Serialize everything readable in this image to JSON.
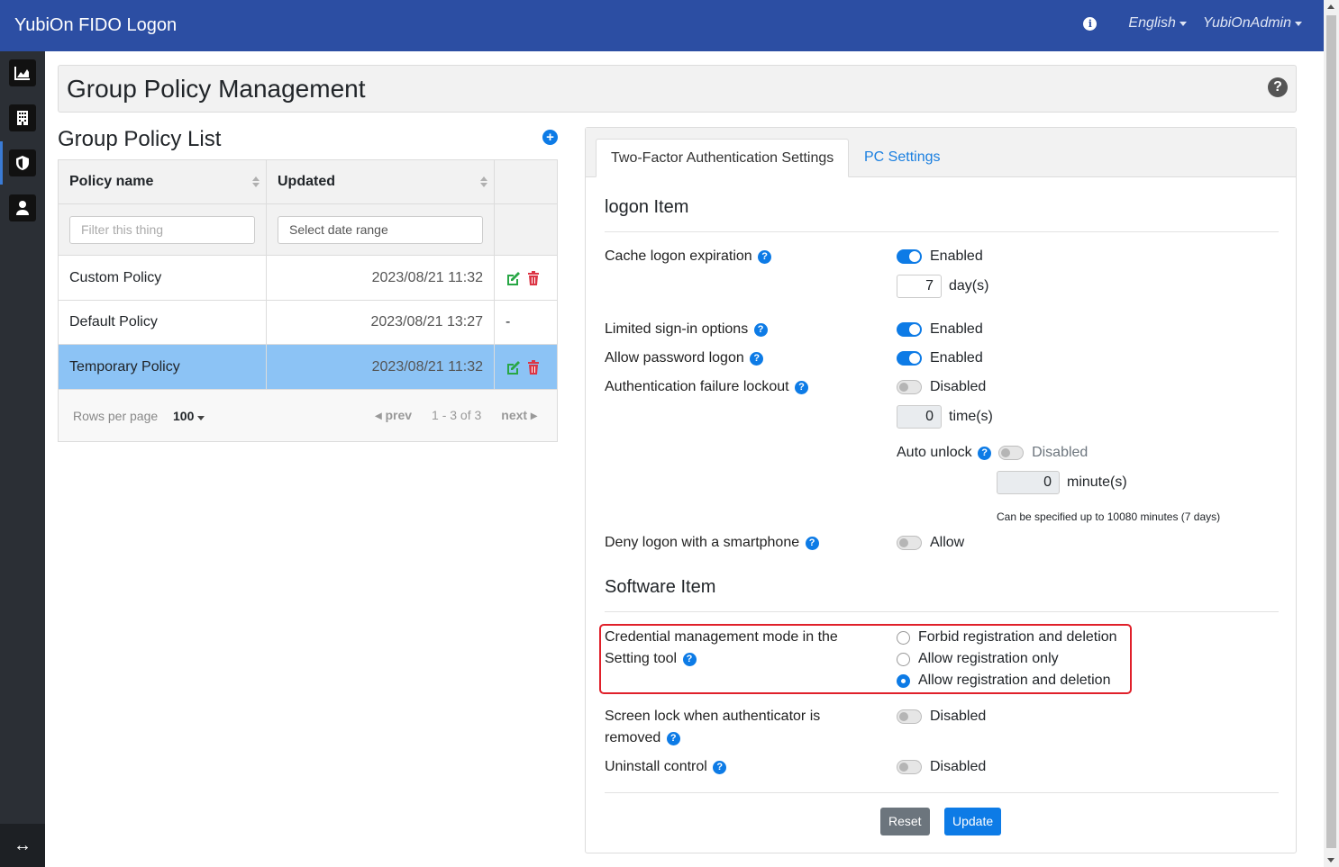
{
  "app": {
    "title": "YubiOn FIDO Logon",
    "language": "English",
    "user": "YubiOnAdmin"
  },
  "sidebar": {
    "items": [
      {
        "icon": "chart-area-icon"
      },
      {
        "icon": "building-icon"
      },
      {
        "icon": "shield-icon"
      },
      {
        "icon": "user-icon"
      }
    ],
    "collapse_icon": "arrows-horizontal-icon"
  },
  "page": {
    "title": "Group Policy Management"
  },
  "policy_list": {
    "title": "Group Policy List",
    "columns": [
      "Policy name",
      "Updated"
    ],
    "filter_placeholder": "Filter this thing",
    "date_placeholder": "Select date range",
    "rows": [
      {
        "name": "Custom Policy",
        "updated": "2023/08/21 11:32",
        "actions": true,
        "dash": ""
      },
      {
        "name": "Default Policy",
        "updated": "2023/08/21 13:27",
        "actions": false,
        "dash": "-"
      },
      {
        "name": "Temporary Policy",
        "updated": "2023/08/21 11:32",
        "actions": true,
        "dash": ""
      }
    ],
    "rows_per_page_label": "Rows per page",
    "rows_per_page": "100",
    "prev": "prev",
    "range": "1 - 3 of 3",
    "next": "next"
  },
  "settings": {
    "tabs": [
      "Two-Factor Authentication Settings",
      "PC Settings"
    ],
    "logon_section": "logon Item",
    "cache_label": "Cache logon expiration",
    "cache_state": "Enabled",
    "cache_value": "7",
    "cache_unit": "day(s)",
    "limited_label": "Limited sign-in options",
    "limited_state": "Enabled",
    "password_label": "Allow password logon",
    "password_state": "Enabled",
    "lockout_label": "Authentication failure lockout",
    "lockout_state": "Disabled",
    "lockout_value": "0",
    "lockout_unit": "time(s)",
    "autounlock_label": "Auto unlock",
    "autounlock_state": "Disabled",
    "autounlock_value": "0",
    "autounlock_unit": "minute(s)",
    "autounlock_note": "Can be specified up to 10080 minutes (7 days)",
    "smartphone_label": "Deny logon with a smartphone",
    "smartphone_state": "Allow",
    "software_section": "Software Item",
    "cred_label_1": "Credential management mode in the",
    "cred_label_2": "Setting tool",
    "cred_options": [
      "Forbid registration and deletion",
      "Allow registration only",
      "Allow registration and deletion"
    ],
    "cred_selected": "Allow registration and deletion",
    "screenlock_label_1": "Screen lock when authenticator is",
    "screenlock_label_2": "removed",
    "screenlock_state": "Disabled",
    "uninstall_label": "Uninstall control",
    "uninstall_state": "Disabled",
    "reset": "Reset",
    "update": "Update"
  },
  "colors": {
    "navbar": "#2c4ea3",
    "sidebar": "#2b2f35",
    "accent": "#0d7be6",
    "selected_row": "#8cc3f5",
    "highlight_box": "#e0202a"
  }
}
